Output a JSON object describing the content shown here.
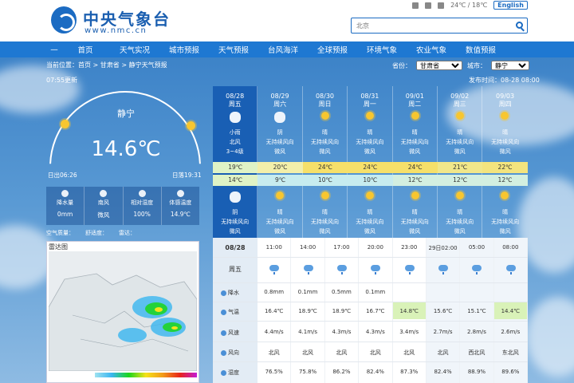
{
  "header": {
    "logo_cn": "中央气象台",
    "logo_en": "www.nmc.cn",
    "topbar": {
      "weather": "24℃ / 18℃",
      "english": "English"
    },
    "search_placeholder": "北京"
  },
  "nav": [
    "首页",
    "天气实况",
    "城市预报",
    "天气预报",
    "台风海洋",
    "全球预报",
    "环境气象",
    "农业气象",
    "数值预报"
  ],
  "breadcrumb": "当前位置：首页 > 甘肃省 > 静宁天气预报",
  "updated": "07:55更新",
  "selects": {
    "province_label": "省份：",
    "province": "甘肃省",
    "city_label": "城市：",
    "city": "静宁"
  },
  "published": "发布时间：08-28 08:00",
  "current": {
    "station": "静宁",
    "temperature": "14.6℃",
    "sunrise": "日出06:26",
    "sunset": "日落19:31",
    "metrics": [
      {
        "icon": "rain-icon",
        "label": "降水量",
        "value": "0mm"
      },
      {
        "icon": "wind-icon",
        "label": "南风",
        "value": "微风"
      },
      {
        "icon": "humidity-icon",
        "label": "相对湿度",
        "value": "100%"
      },
      {
        "icon": "thermometer-icon",
        "label": "体感温度",
        "value": "14.9℃"
      }
    ],
    "aq": [
      "空气质量：",
      "舒适度：",
      "雷达："
    ]
  },
  "radar": {
    "title": "雷达图"
  },
  "forecast": {
    "days": [
      {
        "date": "08/28",
        "week": "周五",
        "day_icon": "cloud-icon",
        "day_desc": "小雨",
        "day_wind": "北风",
        "day_level": "3~4级",
        "high": "19℃",
        "low": "14℃",
        "night_icon": "cloud-icon",
        "night_desc": "阴",
        "night_wind": "无持续风向",
        "night_level": "微风"
      },
      {
        "date": "08/29",
        "week": "周六",
        "day_icon": "cloud-icon",
        "day_desc": "阴",
        "day_wind": "无持续风向",
        "day_level": "微风",
        "high": "20℃",
        "low": "9℃",
        "night_icon": "sun-icon",
        "night_desc": "晴",
        "night_wind": "无持续风向",
        "night_level": "微风"
      },
      {
        "date": "08/30",
        "week": "周日",
        "day_icon": "sun-icon",
        "day_desc": "晴",
        "day_wind": "无持续风向",
        "day_level": "微风",
        "high": "24℃",
        "low": "10℃",
        "night_icon": "sun-icon",
        "night_desc": "晴",
        "night_wind": "无持续风向",
        "night_level": "微风"
      },
      {
        "date": "08/31",
        "week": "周一",
        "day_icon": "sun-icon",
        "day_desc": "晴",
        "day_wind": "无持续风向",
        "day_level": "微风",
        "high": "24℃",
        "low": "10℃",
        "night_icon": "sun-icon",
        "night_desc": "晴",
        "night_wind": "无持续风向",
        "night_level": "微风"
      },
      {
        "date": "09/01",
        "week": "周二",
        "day_icon": "sun-icon",
        "day_desc": "晴",
        "day_wind": "无持续风向",
        "day_level": "微风",
        "high": "24℃",
        "low": "12℃",
        "night_icon": "sun-icon",
        "night_desc": "晴",
        "night_wind": "无持续风向",
        "night_level": "微风"
      },
      {
        "date": "09/02",
        "week": "周三",
        "day_icon": "sun-icon",
        "day_desc": "晴",
        "day_wind": "无持续风向",
        "day_level": "微风",
        "high": "21℃",
        "low": "12℃",
        "night_icon": "sun-icon",
        "night_desc": "晴",
        "night_wind": "无持续风向",
        "night_level": "微风"
      },
      {
        "date": "09/03",
        "week": "周四",
        "day_icon": "sun-icon",
        "day_desc": "晴",
        "day_wind": "无持续风向",
        "day_level": "微风",
        "high": "22℃",
        "low": "12℃",
        "night_icon": "sun-icon",
        "night_desc": "晴",
        "night_wind": "无持续风向",
        "night_level": "微风"
      }
    ]
  },
  "hourly": {
    "date": "08/28",
    "week": "周五",
    "row_labels": [
      "降水",
      "气温",
      "风速",
      "风向",
      "湿度"
    ],
    "times": [
      "11:00",
      "14:00",
      "17:00",
      "20:00",
      "23:00",
      "29日02:00",
      "05:00",
      "08:00"
    ],
    "precip": [
      "0.8mm",
      "0.1mm",
      "0.5mm",
      "0.1mm",
      "",
      "",
      "",
      ""
    ],
    "temp": [
      "16.4℃",
      "18.9℃",
      "18.9℃",
      "16.7℃",
      "14.8℃",
      "15.6℃",
      "15.1℃",
      "14.4℃"
    ],
    "wind_speed": [
      "4.4m/s",
      "4.1m/s",
      "4.3m/s",
      "4.3m/s",
      "3.4m/s",
      "2.7m/s",
      "2.8m/s",
      "2.6m/s"
    ],
    "wind_dir": [
      "北风",
      "北风",
      "北风",
      "北风",
      "北风",
      "北风",
      "西北风",
      "东北风"
    ],
    "humidity": [
      "76.5%",
      "75.8%",
      "86.2%",
      "82.4%",
      "87.3%",
      "82.4%",
      "88.9%",
      "89.6%"
    ]
  }
}
